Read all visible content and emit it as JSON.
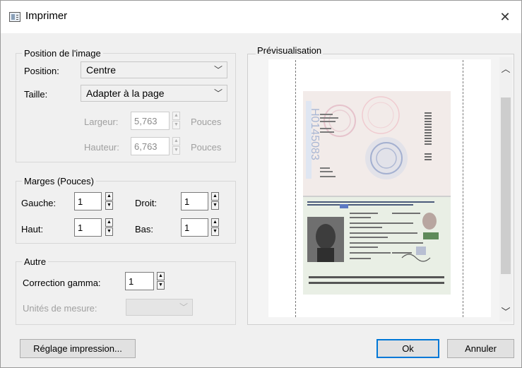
{
  "window": {
    "title": "Imprimer",
    "close_glyph": "✕"
  },
  "position_group": {
    "legend": "Position de l'image",
    "position_label": "Position:",
    "position_value": "Centre",
    "size_label": "Taille:",
    "size_value": "Adapter à la page",
    "width_label": "Largeur:",
    "width_value": "5,763",
    "width_unit": "Pouces",
    "height_label": "Hauteur:",
    "height_value": "6,763",
    "height_unit": "Pouces"
  },
  "margins_group": {
    "legend": "Marges (Pouces)",
    "left_label": "Gauche:",
    "left_value": "1",
    "right_label": "Droit:",
    "right_value": "1",
    "top_label": "Haut:",
    "top_value": "1",
    "bottom_label": "Bas:",
    "bottom_value": "1"
  },
  "other_group": {
    "legend": "Autre",
    "gamma_label": "Correction gamma:",
    "gamma_value": "1",
    "units_label": "Unités de mesure:",
    "units_value": ""
  },
  "preview": {
    "label": "Prévisualisation"
  },
  "buttons": {
    "page_setup": "Réglage impression...",
    "ok": "Ok",
    "cancel": "Annuler"
  },
  "icons": {
    "chevron_down": "﹀",
    "spin_up": "▲",
    "spin_down": "▼",
    "scroll_up": "︿",
    "scroll_down": "﹀"
  },
  "colors": {
    "accent": "#0078d7",
    "dialog_bg": "#f0f0f0",
    "titlebar_bg": "#ffffff"
  }
}
